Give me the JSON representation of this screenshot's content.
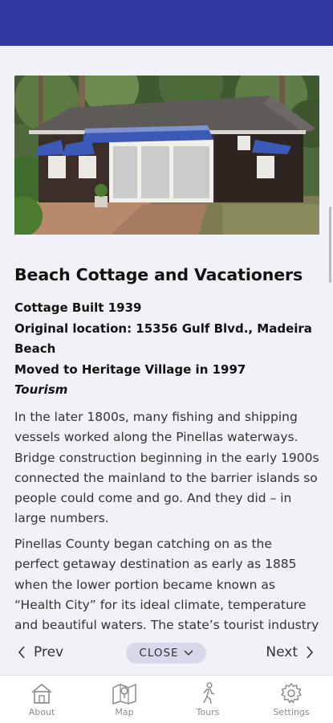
{
  "article": {
    "title": "Beach Cottage and Vacationers",
    "facts": [
      "Cottage Built 1939",
      "Original location: 15356 Gulf Blvd., Madeira Beach",
      "Moved to Heritage Village in 1997"
    ],
    "category": "Tourism",
    "paragraphs": [
      "In the later 1800s, many fishing and shipping vessels worked along the Pinellas waterways. Bridge construction beginning in the early 1900s connected the mainland to the barrier islands so people could come and go. And they did – in large numbers.",
      "Pinellas County began catching on as the perfect getaway destination as early as 1885 when the lower portion became known as “Health City” for its ideal climate, temperature and beautiful waters. The state’s tourist industry traces its real"
    ]
  },
  "nav": {
    "prev_label": "Prev",
    "close_label": "CLOSE",
    "next_label": "Next"
  },
  "tabs": [
    {
      "label": "About",
      "icon": "home-icon"
    },
    {
      "label": "Map",
      "icon": "map-icon"
    },
    {
      "label": "Tours",
      "icon": "walking-person-icon"
    },
    {
      "label": "Settings",
      "icon": "gear-icon"
    }
  ],
  "colors": {
    "header": "#2f3b9e",
    "background": "#f1f2f7",
    "close_pill": "#d6d9ea"
  }
}
